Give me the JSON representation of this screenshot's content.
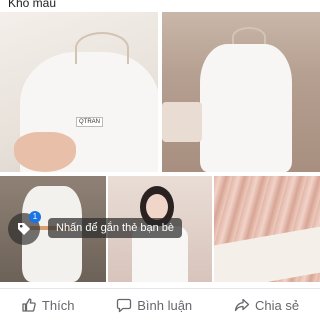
{
  "caption": {
    "text": "Kho mẫu"
  },
  "photos": [
    {
      "id": "photo-1",
      "brand_tag": "QTRAN"
    },
    {
      "id": "photo-2"
    },
    {
      "id": "photo-3"
    },
    {
      "id": "photo-4"
    },
    {
      "id": "photo-5"
    }
  ],
  "tag_overlay": {
    "count": "1",
    "hint": "Nhấn để gắn thẻ bạn bè",
    "icon": "tag-icon"
  },
  "actions": {
    "like_label": "Thích",
    "comment_label": "Bình luận",
    "share_label": "Chia sẻ",
    "like_icon": "thumbs-up-icon",
    "comment_icon": "comment-icon",
    "share_icon": "share-icon"
  },
  "colors": {
    "accent": "#1b74e4",
    "text_muted": "#65676b"
  }
}
